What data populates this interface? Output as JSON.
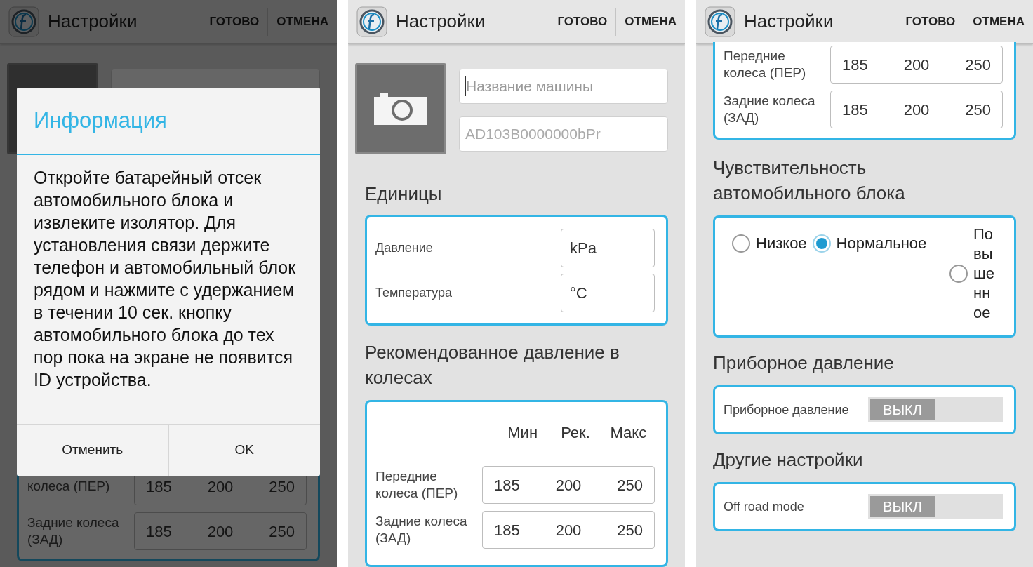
{
  "screens": [
    {
      "kind": "dialog",
      "header": {
        "title": "Настройки",
        "actions": [
          "ГОТОВО",
          "ОТМЕНА"
        ]
      },
      "pressure_rows": [
        {
          "label": "колеса (ПЕР)",
          "values": [
            "185",
            "200",
            "250"
          ]
        },
        {
          "label": "Задние колеса (ЗАД)",
          "values": [
            "185",
            "200",
            "250"
          ]
        }
      ],
      "dialog": {
        "title": "Информация",
        "message": "Откройте батарейный отсек автомобильного блока и извлеките изолятор. Для установления связи держите телефон и автомобильный блок рядом и нажмите с удержанием в течении 10 сек. кнопку автомобильного блока до тех пор пока на экране не появится ID устройства.",
        "buttons": [
          "Отменить",
          "OK"
        ]
      }
    },
    {
      "kind": "units",
      "header": {
        "title": "Настройки",
        "actions": [
          "ГОТОВО",
          "ОТМЕНА"
        ]
      },
      "car_name": {
        "placeholder": "Название машины"
      },
      "device_id": "AD103B0000000bPr",
      "units_title": "Единицы",
      "units": [
        {
          "label": "Давление",
          "value": "kPa"
        },
        {
          "label": "Температура",
          "value": "°C"
        }
      ],
      "pressure_title": "Рекомендованное давление в колесах",
      "pressure_columns": [
        "Мин",
        "Рек.",
        "Макс"
      ],
      "pressure_rows": [
        {
          "label": "Передние колеса (ПЕР)",
          "values": [
            "185",
            "200",
            "250"
          ]
        },
        {
          "label": "Задние колеса (ЗАД)",
          "values": [
            "185",
            "200",
            "250"
          ]
        }
      ]
    },
    {
      "kind": "sensitivity",
      "header": {
        "title": "Настройки",
        "actions": [
          "ГОТОВО",
          "ОТМЕНА"
        ]
      },
      "pressure_rows": [
        {
          "label": "Передние колеса (ПЕР)",
          "values": [
            "185",
            "200",
            "250"
          ]
        },
        {
          "label": "Задние колеса (ЗАД)",
          "values": [
            "185",
            "200",
            "250"
          ]
        }
      ],
      "sensitivity_title": "Чувствительность автомобильного блока",
      "sensitivity_options": [
        {
          "label": "Низкое",
          "selected": false
        },
        {
          "label": "Нормальное",
          "selected": true
        },
        {
          "label": "Повышенное",
          "selected": false
        }
      ],
      "gauge_title": "Приборное давление",
      "gauge": {
        "label": "Приборное давление",
        "on": false,
        "state": "ВЫКЛ"
      },
      "other_title": "Другие настройки",
      "off_road": {
        "label": "Off road mode",
        "on": false,
        "state": "ВЫКЛ"
      }
    }
  ]
}
